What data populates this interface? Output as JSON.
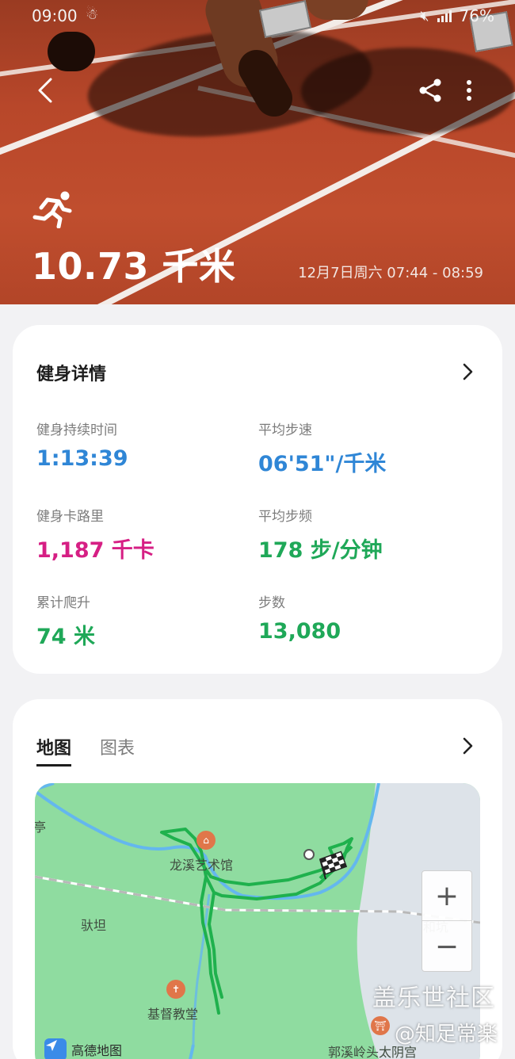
{
  "status_bar": {
    "time": "09:00",
    "battery": "76%"
  },
  "hero": {
    "distance": "10.73 千米",
    "date_range": "12月7日周六 07:44 - 08:59",
    "icons": {
      "back": "back-arrow-icon",
      "share": "share-icon",
      "more": "more-vertical-icon",
      "activity": "running-icon"
    }
  },
  "details": {
    "title": "健身详情",
    "metrics": [
      {
        "label": "健身持续时间",
        "value": "1:13:39",
        "color": "#2f86d6"
      },
      {
        "label": "平均步速",
        "value": "06'51\"/千米",
        "color": "#2f86d6"
      },
      {
        "label": "健身卡路里",
        "value": "1,187 千卡",
        "color": "#d61f84"
      },
      {
        "label": "平均步频",
        "value": "178 步/分钟",
        "color": "#1fa858"
      },
      {
        "label": "累计爬升",
        "value": "74 米",
        "color": "#1fa858"
      },
      {
        "label": "步数",
        "value": "13,080",
        "color": "#1fa858"
      }
    ]
  },
  "map_card": {
    "tabs": [
      "地图",
      "图表"
    ],
    "active_tab": "地图",
    "labels": {
      "ting": "亭",
      "art_museum": "龙溪艺术馆",
      "tan": "驮坦",
      "hekeng": "和坑",
      "church": "基督教堂",
      "temple": "郭溪岭头太阴宫"
    },
    "provider": "高德地图",
    "zoom_in": "+",
    "zoom_out": "−",
    "route_color": "#1fb14d"
  },
  "watermarks": {
    "line1": "盖乐世社区",
    "line2": "@知足常楽"
  }
}
